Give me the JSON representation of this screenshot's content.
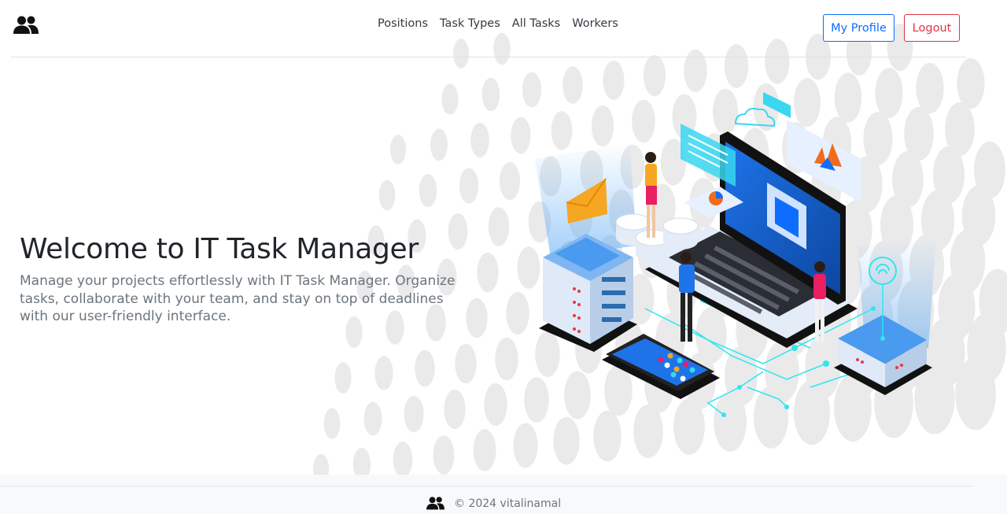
{
  "app": {
    "logo_icon": "users-icon"
  },
  "nav": {
    "links": [
      {
        "label": "Positions"
      },
      {
        "label": "Task Types"
      },
      {
        "label": "All Tasks"
      },
      {
        "label": "Workers"
      }
    ],
    "profile_label": "My Profile",
    "logout_label": "Logout"
  },
  "hero": {
    "title": "Welcome to IT Task Manager",
    "description": "Manage your projects effortlessly with IT Task Manager. Organize tasks, collaborate with your team, and stay on top of deadlines with our user-friendly interface.",
    "illustration": "isometric-it-workspace-illustration"
  },
  "footer": {
    "icon": "users-icon",
    "text": "© 2024 vitalinamal"
  },
  "colors": {
    "primary": "#0d6efd",
    "danger": "#dc3545",
    "muted": "#6c757d",
    "footer_bg": "#f8f9fa",
    "accent_cyan": "#22d3ee",
    "accent_blue": "#1e73e8"
  }
}
